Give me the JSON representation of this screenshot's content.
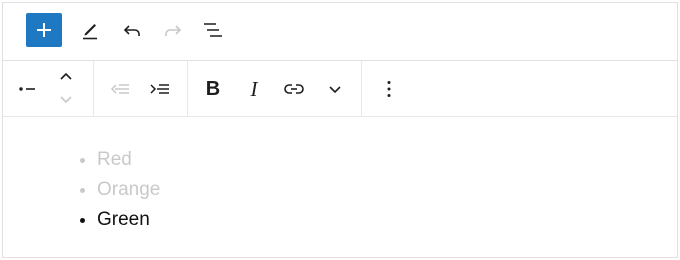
{
  "colors": {
    "accent": "#1e78c2",
    "icon": "#1e1e1e",
    "icon_disabled": "#c8c8c8",
    "text": "#111111",
    "text_muted": "#c9c9c9",
    "border": "#e0e0e0"
  },
  "top_toolbar": {
    "icons": [
      "plus-icon",
      "pencil-icon",
      "undo-icon",
      "redo-icon",
      "list-view-icon"
    ],
    "redo_disabled": true
  },
  "block_toolbar": {
    "groups": [
      [
        "list-bullet-icon",
        "move-up-icon",
        "move-down-icon"
      ],
      [
        "outdent-icon",
        "indent-icon"
      ],
      [
        "bold-icon",
        "italic-icon",
        "link-icon",
        "chevron-down-icon"
      ],
      [
        "more-options-icon"
      ]
    ],
    "bold_label": "B",
    "italic_label": "I",
    "move_down_disabled": true,
    "outdent_disabled": true
  },
  "list": {
    "items": [
      {
        "text": "Red",
        "state": "muted"
      },
      {
        "text": "Orange",
        "state": "muted"
      },
      {
        "text": "Green",
        "state": "active"
      }
    ]
  }
}
